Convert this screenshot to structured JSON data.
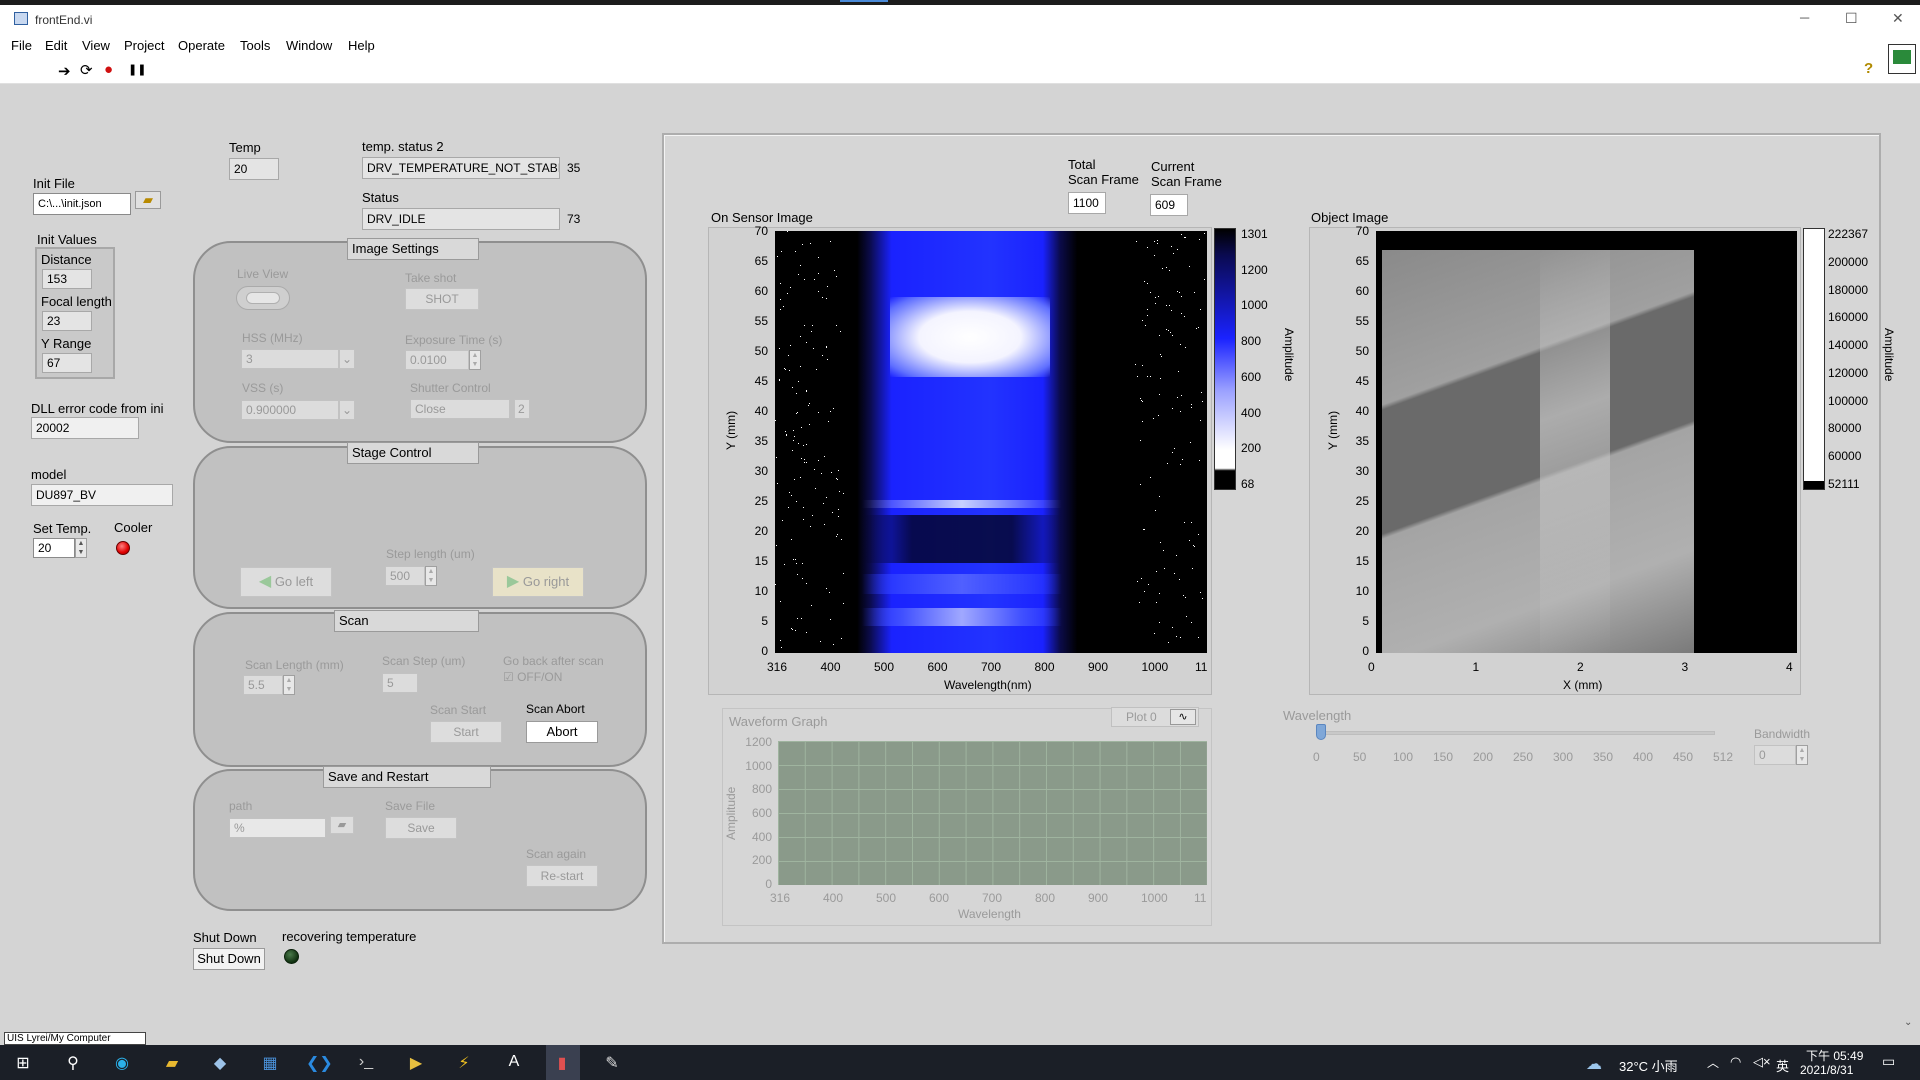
{
  "window": {
    "title": "frontEnd.vi",
    "min_label": "─",
    "max_label": "☐",
    "close_label": "✕"
  },
  "menu": [
    "File",
    "Edit",
    "View",
    "Project",
    "Operate",
    "Tools",
    "Window",
    "Help"
  ],
  "toolbar": {
    "run_icon": "➔",
    "runcont_icon": "⟳",
    "abort_icon": "●",
    "pause_icon": "❚❚",
    "help_icon": "?"
  },
  "left": {
    "init_file_label": "Init File",
    "init_file_value": "C:\\...\\init.json",
    "init_values_label": "Init Values",
    "distance_label": "Distance",
    "distance_value": "153",
    "focal_label": "Focal length",
    "focal_value": "23",
    "yrange_label": "Y Range",
    "yrange_value": "67",
    "dll_label": "DLL error code from ini",
    "dll_value": "20002",
    "model_label": "model",
    "model_value": "DU897_BV",
    "settemp_label": "Set Temp.",
    "settemp_value": "20",
    "cooler_label": "Cooler",
    "shutdown_label": "Shut Down",
    "shutdown_button": "Shut Down",
    "recover_label": "recovering temperature"
  },
  "status": {
    "temp_label": "Temp",
    "temp_value": "20",
    "tempstatus_label": "temp. status 2",
    "tempstatus_value": "DRV_TEMPERATURE_NOT_STABI",
    "tempstatus_code": "35",
    "status_label": "Status",
    "status_value": "DRV_IDLE",
    "status_code": "73"
  },
  "image_settings": {
    "title": "Image Settings",
    "liveview_label": "Live View",
    "takeshot_label": "Take shot",
    "shot_button": "SHOT",
    "hss_label": "HSS (MHz)",
    "hss_value": "3",
    "exposure_label": "Exposure Time (s)",
    "exposure_value": "0.0100",
    "vss_label": "VSS (s)",
    "vss_value": "0.900000",
    "shutter_label": "Shutter Control",
    "shutter_value": "Close",
    "shutter_code": "2"
  },
  "stage": {
    "title": "Stage Control",
    "step_label": "Step length (um)",
    "step_value": "500",
    "left_button": "Go left",
    "right_button": "Go right"
  },
  "scan": {
    "title": "Scan",
    "length_label": "Scan Length (mm)",
    "length_value": "5.5",
    "step_label": "Scan Step (um)",
    "step_value": "5",
    "goback_label": "Go back after scan",
    "goback_toggle": "OFF/ON",
    "start_label": "Scan Start",
    "start_button": "Start",
    "abort_label": "Scan Abort",
    "abort_button": "Abort"
  },
  "save": {
    "title": "Save and Restart",
    "path_label": "path",
    "savefile_label": "Save File",
    "save_button": "Save",
    "again_label": "Scan again",
    "restart_button": "Re-start"
  },
  "frames": {
    "total_label_1": "Total",
    "total_label_2": "Scan Frame",
    "total_value": "1100",
    "current_label_1": "Current",
    "current_label_2": "Scan Frame",
    "current_value": "609"
  },
  "sensor": {
    "title": "On Sensor Image",
    "xlabel": "Wavelength(nm)",
    "ylabel": "Y (mm)",
    "xticks": [
      "316",
      "400",
      "500",
      "600",
      "700",
      "800",
      "900",
      "1000",
      "11"
    ],
    "yticks": [
      "70",
      "65",
      "60",
      "55",
      "50",
      "45",
      "40",
      "35",
      "30",
      "25",
      "20",
      "15",
      "10",
      "5",
      "0"
    ],
    "scale_label": "Amplitude",
    "scale_ticks": [
      "1301",
      "1200",
      "1000",
      "800",
      "600",
      "400",
      "200",
      "68"
    ],
    "colors": {
      "low": "#000000",
      "mid": "#1a22ff",
      "high": "#ffffff"
    }
  },
  "object": {
    "title": "Object Image",
    "xlabel": "X (mm)",
    "ylabel": "Y (mm)",
    "xticks": [
      "0",
      "1",
      "2",
      "3",
      "4"
    ],
    "yticks": [
      "70",
      "65",
      "60",
      "55",
      "50",
      "45",
      "40",
      "35",
      "30",
      "25",
      "20",
      "15",
      "10",
      "5",
      "0"
    ],
    "scale_label": "Amplitude",
    "scale_ticks": [
      "222367",
      "200000",
      "180000",
      "160000",
      "140000",
      "120000",
      "100000",
      "80000",
      "60000",
      "52111"
    ]
  },
  "waveform": {
    "title": "Waveform Graph",
    "plot_label": "Plot 0",
    "xlabel": "Wavelength",
    "ylabel": "Amplitude",
    "xticks": [
      "316",
      "400",
      "500",
      "600",
      "700",
      "800",
      "900",
      "1000",
      "11"
    ],
    "yticks": [
      "1200",
      "1000",
      "800",
      "600",
      "400",
      "200",
      "0"
    ]
  },
  "wavelength": {
    "label": "Wavelength",
    "ticks": [
      "0",
      "50",
      "100",
      "150",
      "200",
      "250",
      "300",
      "350",
      "400",
      "450",
      "512"
    ],
    "bandwidth_label": "Bandwidth",
    "bandwidth_value": "0"
  },
  "statusbar": {
    "path": "UIS Lyrei/My Computer"
  },
  "taskbar": {
    "weather": "32°C 小雨",
    "ime": "英",
    "time": "下午 05:49",
    "date": "2021/8/31",
    "start_icon": "windows-icon",
    "search_icon": "search-icon"
  }
}
